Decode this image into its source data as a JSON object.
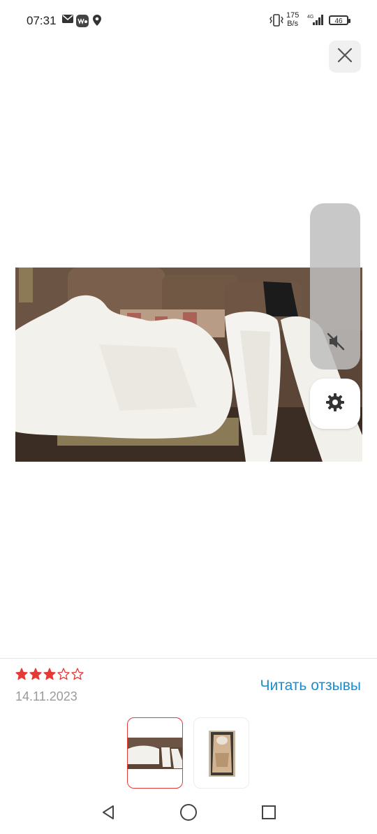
{
  "status_bar": {
    "time": "07:31",
    "net_speed_value": "175",
    "net_speed_unit": "B/s",
    "network": "4G",
    "battery": "46",
    "icons": [
      "mail-icon",
      "wb-app-icon",
      "location-icon",
      "vibrate-icon",
      "signal-icon",
      "battery-icon"
    ]
  },
  "viewer": {
    "close_icon": "close-icon",
    "mute_icon": "volume-off-icon",
    "settings_icon": "gear-icon"
  },
  "review": {
    "rating": 3,
    "max_rating": 5,
    "date": "14.11.2023",
    "read_reviews_label": "Читать отзывы",
    "star_color": "#e53935",
    "link_color": "#1a8ccf"
  },
  "thumbnails": [
    {
      "name": "thumbnail-1",
      "selected": true
    },
    {
      "name": "thumbnail-2",
      "selected": false
    }
  ],
  "nav_bar": {
    "icons": [
      "back-icon",
      "home-icon",
      "recents-icon"
    ]
  }
}
